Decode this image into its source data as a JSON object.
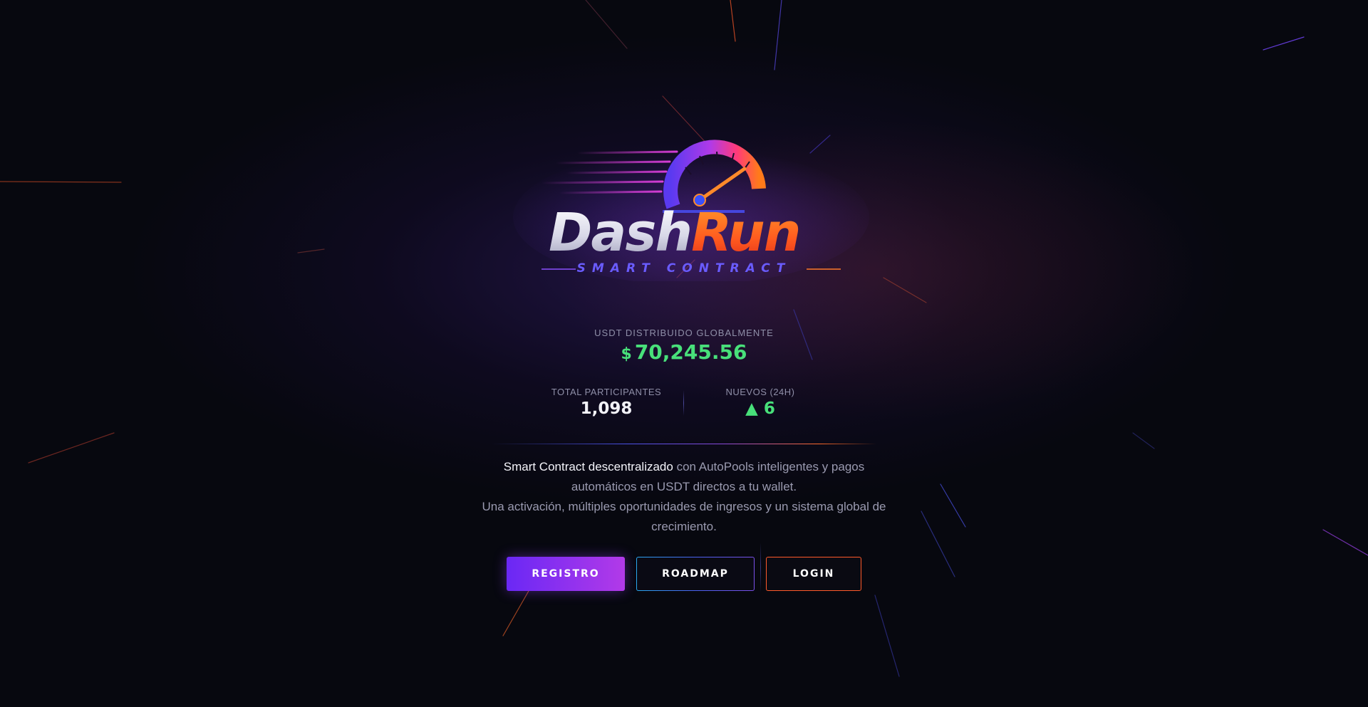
{
  "brand": {
    "name_part1": "Dash",
    "name_part2": "Run",
    "tagline": "SMART CONTRACT"
  },
  "stats": {
    "global_label": "USDT DISTRIBUIDO GLOBALMENTE",
    "global_currency": "$",
    "global_value": "70,245.56",
    "participants_label": "TOTAL PARTICIPANTES",
    "participants_value": "1,098",
    "new_label": "NUEVOS (24H)",
    "new_value": "▲ 6"
  },
  "description": {
    "highlight": "Smart Contract descentralizado",
    "line1_rest": " con AutoPools inteligentes y pagos automáticos en USDT directos a tu wallet.",
    "line2": "Una activación, múltiples oportunidades de ingresos y un sistema global de crecimiento."
  },
  "buttons": {
    "registro": "REGISTRO",
    "roadmap": "ROADMAP",
    "login": "LOGIN"
  },
  "colors": {
    "background": "#07080f",
    "accent_purple": "#6a28f5",
    "accent_magenta": "#b23ae8",
    "accent_orange": "#ff5a2a",
    "accent_blue": "#2aa8f0",
    "positive_green": "#48e07a",
    "muted_text": "#9a9ab0"
  },
  "icons": {
    "logo_gauge": "speedometer-icon",
    "trend_up": "triangle-up-icon"
  }
}
